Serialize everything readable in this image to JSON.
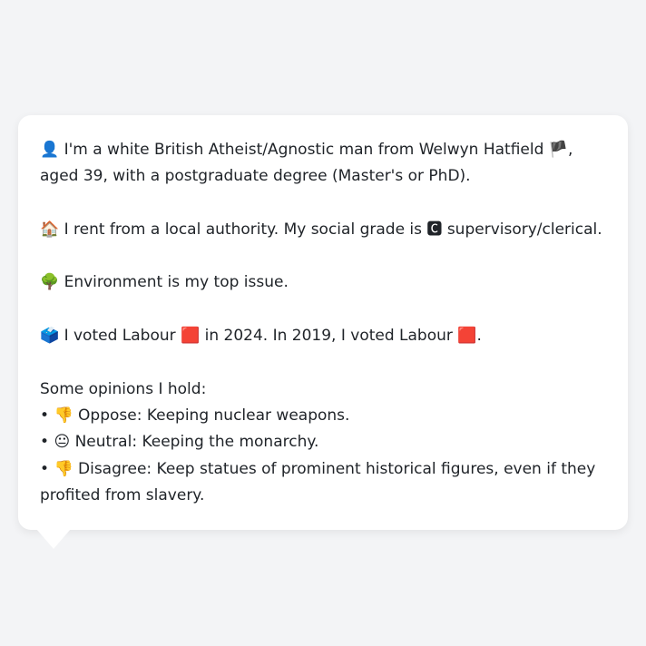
{
  "profile": {
    "identity": {
      "icon": "👤",
      "text_before_flag": "I'm a white British Atheist/Agnostic man from Welwyn Hatfield",
      "flag": "🏴",
      "text_after_flag": ", aged 39, with a postgraduate degree (Master's or PhD)."
    },
    "housing": {
      "icon": "🏠",
      "text_before_badge": "I rent from a local authority. My social grade is",
      "badge": "🅲",
      "text_after_badge": "supervisory/clerical."
    },
    "issue": {
      "icon": "🌳",
      "text": "Environment is my top issue."
    },
    "vote": {
      "icon": "🗳️",
      "text_a": "I voted Labour",
      "square_a": "🟥",
      "text_b": "in 2024. In 2019, I voted Labour",
      "square_b": "🟥",
      "text_c": "."
    },
    "opinions": {
      "heading": "Some opinions I hold:",
      "items": [
        {
          "bullet": "•",
          "icon": "👎",
          "text": "Oppose: Keeping nuclear weapons."
        },
        {
          "bullet": "•",
          "icon": "😐",
          "text": "Neutral: Keeping the monarchy."
        },
        {
          "bullet": "•",
          "icon": "👎",
          "text": "Disagree: Keep statues of prominent historical figures, even if they profited from slavery."
        }
      ]
    }
  },
  "colors": {
    "page_background": "#f3f4f6",
    "bubble_background": "#ffffff",
    "text": "#1f2328"
  }
}
